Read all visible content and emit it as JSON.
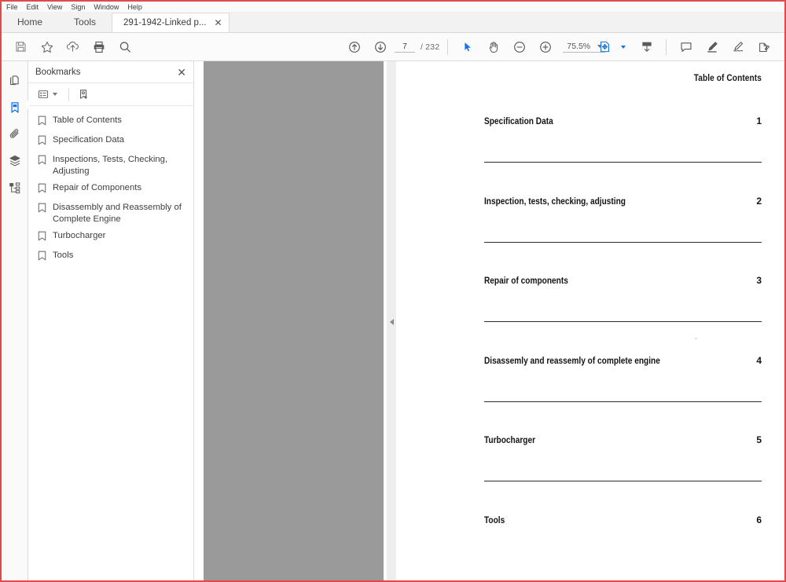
{
  "menubar": {
    "items": [
      {
        "label": "File"
      },
      {
        "label": "Edit"
      },
      {
        "label": "View"
      },
      {
        "label": "Sign"
      },
      {
        "label": "Window"
      },
      {
        "label": "Help"
      }
    ]
  },
  "tabbar": {
    "home_label": "Home",
    "tools_label": "Tools",
    "document_tab": {
      "title": "291-1942-Linked p...",
      "close_glyph": "✕"
    }
  },
  "toolbar": {
    "left_tools": [
      {
        "name": "save-icon",
        "tip": "Save"
      },
      {
        "name": "star-icon",
        "tip": "Add to favorites"
      },
      {
        "name": "cloud-upload-icon",
        "tip": "Upload"
      },
      {
        "name": "print-icon",
        "tip": "Print"
      },
      {
        "name": "search-icon",
        "tip": "Find"
      }
    ],
    "nav": {
      "previous_page_icon": "arrow-up-circle-icon",
      "next_page_icon": "arrow-down-circle-icon",
      "current_page": "7",
      "page_total": "/ 232",
      "page_placeholder": "Page"
    },
    "view_tools": [
      {
        "name": "select-cursor-icon"
      },
      {
        "name": "hand-tool-icon"
      },
      {
        "name": "zoom-out-icon"
      },
      {
        "name": "zoom-in-icon"
      }
    ],
    "zoom": {
      "value": "75.5%"
    },
    "right_tools": [
      {
        "name": "page-fit-icon",
        "accent": true
      },
      {
        "name": "download-icon"
      },
      {
        "name": "comment-icon"
      },
      {
        "name": "highlight-icon"
      },
      {
        "name": "sign-icon"
      },
      {
        "name": "share-icon"
      }
    ]
  },
  "rail": {
    "items": [
      {
        "name": "page-thumbnails-icon",
        "active": false
      },
      {
        "name": "bookmarks-icon",
        "active": true
      },
      {
        "name": "attachments-icon",
        "active": false
      },
      {
        "name": "layers-icon",
        "active": false
      },
      {
        "name": "tags-icon",
        "active": false
      }
    ]
  },
  "panel": {
    "title": "Bookmarks",
    "close_glyph": "✕",
    "options_icon": "bookmark-options-icon",
    "new_bookmark_icon": "new-bookmark-icon",
    "bookmarks": [
      {
        "label": "Table of Contents"
      },
      {
        "label": "Specification Data"
      },
      {
        "label": "Inspections, Tests, Checking, Adjusting"
      },
      {
        "label": "Repair of Components"
      },
      {
        "label": "Disassembly and Reassembly of Complete Engine"
      },
      {
        "label": "Turbocharger"
      },
      {
        "label": "Tools"
      }
    ]
  },
  "document": {
    "header": "Table of Contents",
    "entries": [
      {
        "title": "Specification Data",
        "page": "1"
      },
      {
        "title": "Inspection, tests, checking, adjusting",
        "page": "2"
      },
      {
        "title": "Repair of components",
        "page": "3"
      },
      {
        "title": "Disassemly and reassemly of complete engine",
        "page": "4"
      },
      {
        "title": "Turbocharger",
        "page": "5"
      },
      {
        "title": "Tools",
        "page": "6"
      }
    ]
  },
  "colors": {
    "accent": "#1473e6",
    "canvas_gray": "#9a9a9a",
    "window_border": "#e04a4a"
  }
}
